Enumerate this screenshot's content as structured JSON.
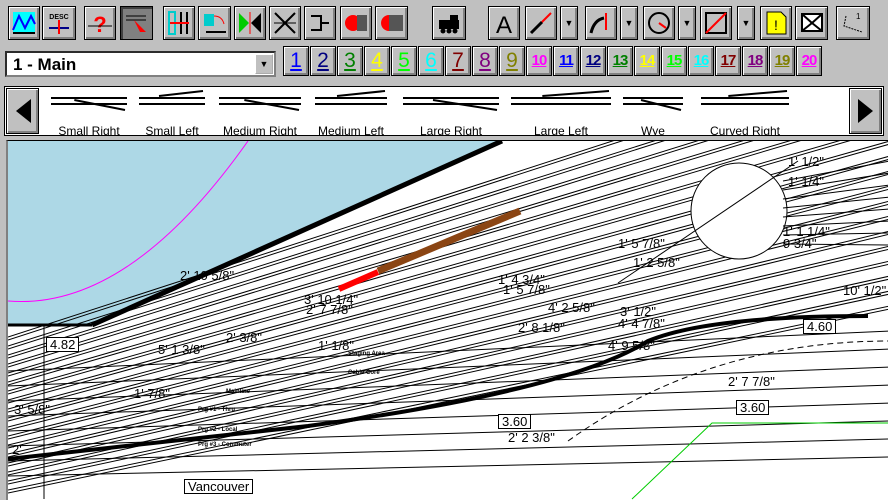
{
  "toolbar": {
    "buttons": [
      {
        "name": "elevation-profile",
        "icon": "elevation-icon"
      },
      {
        "name": "description",
        "icon": "desc-icon",
        "text": "DESC"
      },
      {
        "name": "track-help",
        "icon": "question-track-icon"
      },
      {
        "name": "select-track",
        "icon": "select-arrow-icon",
        "pressed": true
      },
      {
        "name": "join-track",
        "icon": "join-track-icon"
      },
      {
        "name": "flex-track",
        "icon": "flex-track-icon"
      },
      {
        "name": "split-track",
        "icon": "split-icon"
      },
      {
        "name": "disconnect-track",
        "icon": "disconnect-icon"
      },
      {
        "name": "bumper",
        "icon": "bumper-icon"
      },
      {
        "name": "signal-red",
        "icon": "signal-icon"
      },
      {
        "name": "signal-half",
        "icon": "signal-half-icon"
      },
      {
        "name": "train",
        "icon": "locomotive-icon"
      },
      {
        "name": "text",
        "icon": "text-icon",
        "text": "A"
      },
      {
        "name": "draw-line",
        "icon": "line-icon"
      },
      {
        "name": "draw-curve",
        "icon": "curve-icon"
      },
      {
        "name": "draw-circle",
        "icon": "circle-icon"
      },
      {
        "name": "draw-rect",
        "icon": "rectangle-icon"
      },
      {
        "name": "note",
        "icon": "note-icon"
      },
      {
        "name": "ruler",
        "icon": "dimension-icon"
      },
      {
        "name": "misc",
        "icon": "measure-icon",
        "text": "1"
      }
    ]
  },
  "layer_select": {
    "value": "1 - Main"
  },
  "layers": [
    {
      "label": "1",
      "color": "#0000ff"
    },
    {
      "label": "2",
      "color": "#000080"
    },
    {
      "label": "3",
      "color": "#008000"
    },
    {
      "label": "4",
      "color": "#ffff00"
    },
    {
      "label": "5",
      "color": "#00ff00"
    },
    {
      "label": "6",
      "color": "#00ffff"
    },
    {
      "label": "7",
      "color": "#800000"
    },
    {
      "label": "8",
      "color": "#800080"
    },
    {
      "label": "9",
      "color": "#808000"
    },
    {
      "label": "10",
      "color": "#ff00ff"
    },
    {
      "label": "11",
      "color": "#0000ff"
    },
    {
      "label": "12",
      "color": "#000080"
    },
    {
      "label": "13",
      "color": "#008000"
    },
    {
      "label": "14",
      "color": "#ffff00"
    },
    {
      "label": "15",
      "color": "#00ff00"
    },
    {
      "label": "16",
      "color": "#00ffff"
    },
    {
      "label": "17",
      "color": "#800000"
    },
    {
      "label": "18",
      "color": "#800080"
    },
    {
      "label": "19",
      "color": "#808000"
    },
    {
      "label": "20",
      "color": "#ff00ff"
    }
  ],
  "palette": {
    "items": [
      "Small Right",
      "Small Left",
      "Medium Right",
      "Medium Left",
      "Large Right",
      "Large Left",
      "Wye",
      "Curved Right"
    ]
  },
  "canvas": {
    "colors": {
      "water": "#add8e6",
      "magenta": "#ff00ff",
      "train": "#8b4513",
      "engine": "#ff0000",
      "green": "#00cc00"
    },
    "labels": [
      "2' 10 5/8\"",
      "3' 10 1/4\"",
      "2' 7 7/8\"",
      "4.82",
      "5' 1 3/8\"",
      "2' 3/8\"",
      "1' 1/8\"",
      "3' 5/8\"",
      "1' 7/8\"",
      "1' 4 3/4\"",
      "1' 5 7/8\"",
      "1' 2 5/8\"",
      "1' 5 7/8\"",
      "9 3/4\"",
      "1' 1 1/4\"",
      "10' 1/2\"",
      "4' 2 5/8\"",
      "2' 8 1/8\"",
      "4' 4 7/8\"",
      "4' 9 5/8\"",
      "3' 1/2\"",
      "4.60",
      "2' 7 7/8\"",
      "3.60",
      "3.60",
      "2' 2 3/8\"",
      "Vancouver",
      "1' 1/2\"",
      "1' 1/4\"",
      "2'"
    ],
    "sidings": [
      "Staging Area",
      "Cable Core",
      "Mainline",
      "Prg #1 - Thru",
      "Prg #2 - Local",
      "Prg #3 - Commuter"
    ]
  }
}
